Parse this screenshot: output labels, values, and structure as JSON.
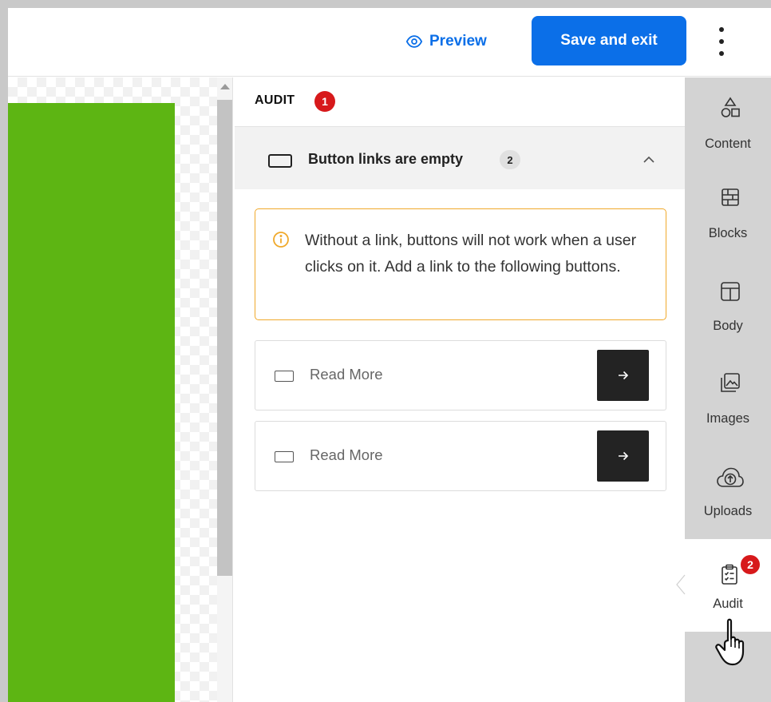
{
  "topbar": {
    "preview_label": "Preview",
    "save_label": "Save and exit"
  },
  "panel": {
    "title": "AUDIT",
    "issue_count": "1",
    "issue": {
      "label": "Button links are empty",
      "count": "2"
    },
    "warning_text": "Without a link, buttons will not work when a user clicks on it. Add a link to the following buttons.",
    "buttons": [
      {
        "label": "Read More"
      },
      {
        "label": "Read More"
      }
    ]
  },
  "sidebar": {
    "items": [
      {
        "label": "Content",
        "icon": "shapes-icon"
      },
      {
        "label": "Blocks",
        "icon": "blocks-icon"
      },
      {
        "label": "Body",
        "icon": "layout-icon"
      },
      {
        "label": "Images",
        "icon": "images-icon"
      },
      {
        "label": "Uploads",
        "icon": "cloud-upload-icon"
      },
      {
        "label": "Audit",
        "icon": "clipboard-check-icon",
        "badge": "2"
      }
    ]
  },
  "colors": {
    "accent": "#0b6fe8",
    "error_badge": "#d7191b",
    "warning_border": "#f0a92b",
    "canvas_block": "#5db513"
  }
}
